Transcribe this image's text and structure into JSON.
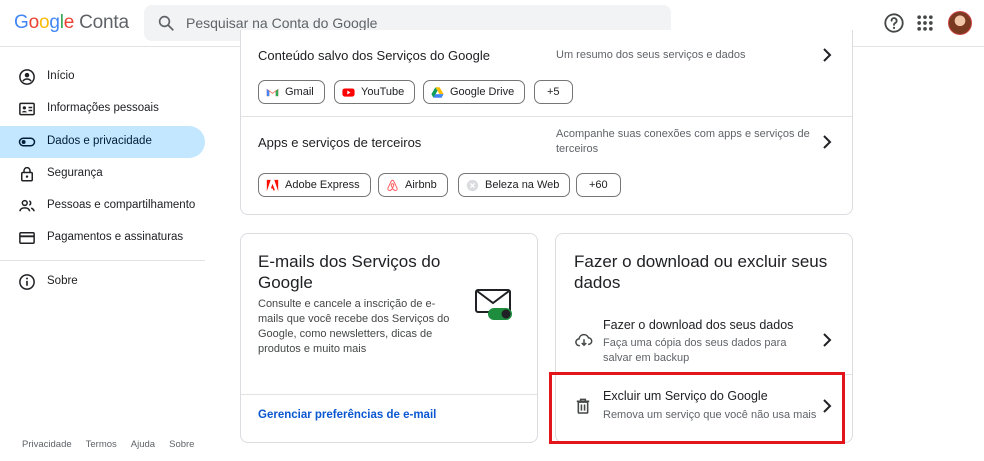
{
  "header": {
    "logo_word": "Google",
    "logo_suffix": "Conta",
    "search_placeholder": "Pesquisar na Conta do Google",
    "icons": [
      "search-icon",
      "help-icon",
      "apps-grid-icon",
      "avatar"
    ]
  },
  "sidebar": {
    "items": [
      {
        "label": "Início",
        "icon": "account-circle-icon",
        "active": false
      },
      {
        "label": "Informações pessoais",
        "icon": "id-card-icon",
        "active": false
      },
      {
        "label": "Dados e privacidade",
        "icon": "toggle-icon",
        "active": true
      },
      {
        "label": "Segurança",
        "icon": "lock-icon",
        "active": false
      },
      {
        "label": "Pessoas e compartilhamento",
        "icon": "people-icon",
        "active": false
      },
      {
        "label": "Pagamentos e assinaturas",
        "icon": "credit-card-icon",
        "active": false
      },
      {
        "label": "Sobre",
        "icon": "info-icon",
        "active": false
      }
    ],
    "footer": [
      "Privacidade",
      "Termos",
      "Ajuda",
      "Sobre"
    ]
  },
  "top_card": {
    "saved_content": {
      "title": "Conteúdo salvo dos Serviços do Google",
      "description": "Um resumo dos seus serviços e dados",
      "chips": [
        {
          "label": "Gmail",
          "icon": "gmail-icon"
        },
        {
          "label": "YouTube",
          "icon": "youtube-icon"
        },
        {
          "label": "Google Drive",
          "icon": "drive-icon"
        },
        {
          "label": "+5"
        }
      ]
    },
    "third_party": {
      "title": "Apps e serviços de terceiros",
      "description": "Acompanhe suas conexões com apps e serviços de terceiros",
      "chips": [
        {
          "label": "Adobe Express",
          "icon": "adobe-icon"
        },
        {
          "label": "Airbnb",
          "icon": "airbnb-icon"
        },
        {
          "label": "Beleza na Web",
          "icon": "generic-app-icon"
        },
        {
          "label": "+60"
        }
      ]
    }
  },
  "emails_card": {
    "title": "E-mails dos Serviços do Google",
    "body": "Consulte e cancele a inscrição de e-mails que você recebe dos Serviços do Google, como newsletters, dicas de produtos e muito mais",
    "link": "Gerenciar preferências de e-mail"
  },
  "download_card": {
    "title": "Fazer o download ou excluir seus dados",
    "rows": [
      {
        "title": "Fazer o download dos seus dados",
        "description": "Faça uma cópia dos seus dados para salvar em backup",
        "icon": "cloud-download-icon"
      },
      {
        "title": "Excluir um Serviço do Google",
        "description": "Remova um serviço que você não usa mais",
        "icon": "trash-icon"
      }
    ]
  },
  "colors": {
    "active_nav": "#c2e7ff",
    "link": "#0b57d0",
    "highlight_border": "#e2151a"
  }
}
